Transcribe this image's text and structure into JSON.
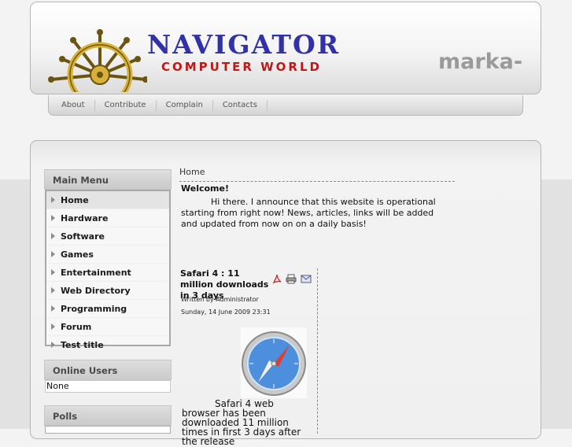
{
  "header": {
    "logo_title": "NAVIGATOR",
    "logo_subtitle": "COMPUTER WORLD",
    "marka": "marka-"
  },
  "nav": [
    {
      "label": "About"
    },
    {
      "label": "Contribute"
    },
    {
      "label": "Complain"
    },
    {
      "label": "Contacts"
    }
  ],
  "sidebar": {
    "main_menu_title": "Main Menu",
    "items": [
      {
        "label": "Home"
      },
      {
        "label": "Hardware"
      },
      {
        "label": "Software"
      },
      {
        "label": "Games"
      },
      {
        "label": "Entertainment"
      },
      {
        "label": "Web Directory"
      },
      {
        "label": "Programming"
      },
      {
        "label": "Forum"
      },
      {
        "label": "Test title"
      }
    ],
    "online_users_title": "Online Users",
    "online_users_value": "None",
    "polls_title": "Polls"
  },
  "main": {
    "breadcrumb": "Home",
    "welcome_title": "Welcome!",
    "welcome_text": "Hi there. I announce that this website is operational starting from right now! News, articles, links will be added and updated from now on on a daily basis!",
    "article": {
      "title": "Safari 4 : 11 million downloads in 3 days",
      "author": "Written by Administrator",
      "date": "Sunday, 14 June 2009 23:31",
      "body": "Safari 4 web browser has been downloaded 11 million times in first 3 days after the release"
    }
  },
  "colors": {
    "logo_blue": "#3232a8",
    "logo_red": "#c01818",
    "marka_gray": "#9a9a9a"
  },
  "icons": [
    "ship-wheel-icon",
    "pdf-icon",
    "print-icon",
    "email-icon",
    "safari-compass-icon"
  ]
}
